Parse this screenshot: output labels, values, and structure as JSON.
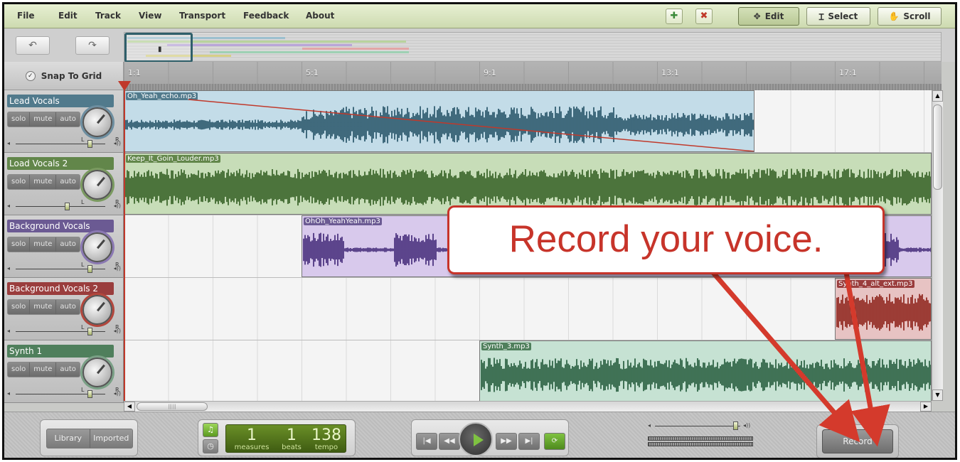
{
  "menu": {
    "items": [
      "File",
      "Edit",
      "Track",
      "View",
      "Transport",
      "Feedback",
      "About"
    ]
  },
  "toolbar": {
    "modes": [
      {
        "label": "Edit",
        "icon": "move-arrows-icon",
        "active": true
      },
      {
        "label": "Select",
        "icon": "text-cursor-icon",
        "active": false
      },
      {
        "label": "Scroll",
        "icon": "hand-icon",
        "active": false
      }
    ]
  },
  "snap": {
    "label": "Snap To Grid"
  },
  "ruler": {
    "marks": [
      "1:1",
      "5:1",
      "9:1",
      "13:1",
      "17:1"
    ]
  },
  "tracks": [
    {
      "name": "Lead Vocals",
      "color": "#517a8c",
      "buttons": [
        "solo",
        "mute",
        "auto"
      ],
      "clip": "Oh_Yeah_echo.mp3",
      "clip_color": "#c3dce8",
      "wave_color": "#1f4d62",
      "volume": 0.8
    },
    {
      "name": "Load Vocals 2",
      "color": "#62864a",
      "buttons": [
        "solo",
        "mute",
        "auto"
      ],
      "clip": "Keep_It_Goin_Louder.mp3",
      "clip_color": "#c7ddb8",
      "wave_color": "#2e5a1d",
      "volume": 0.55
    },
    {
      "name": "Background Vocals",
      "color": "#6b5a93",
      "buttons": [
        "solo",
        "mute",
        "auto"
      ],
      "clip": "OhOh_YeahYeah.mp3",
      "clip_color": "#d8c9ec",
      "wave_color": "#3d2474",
      "volume": 0.8
    },
    {
      "name": "Background Vocals 2",
      "color": "#9a3d3d",
      "buttons": [
        "solo",
        "mute",
        "auto"
      ],
      "clip": "Synth_4_alt_ext.mp3",
      "clip_color": "#e7c3c3",
      "wave_color": "#8a1b12",
      "volume": 0.8
    },
    {
      "name": "Synth 1",
      "color": "#4f7f5c",
      "buttons": [
        "solo",
        "mute",
        "auto"
      ],
      "clip": "Synth_3.mp3",
      "clip_color": "#c6e2d3",
      "wave_color": "#1e5736",
      "volume": 0.8
    }
  ],
  "transport": {
    "library_tabs": [
      "Library",
      "Imported"
    ],
    "counter": {
      "measures": "1",
      "beats": "1",
      "tempo": "138",
      "measures_label": "measures",
      "beats_label": "beats",
      "tempo_label": "tempo"
    },
    "record_label": "Record"
  },
  "annotation": {
    "text": "Record your voice."
  }
}
